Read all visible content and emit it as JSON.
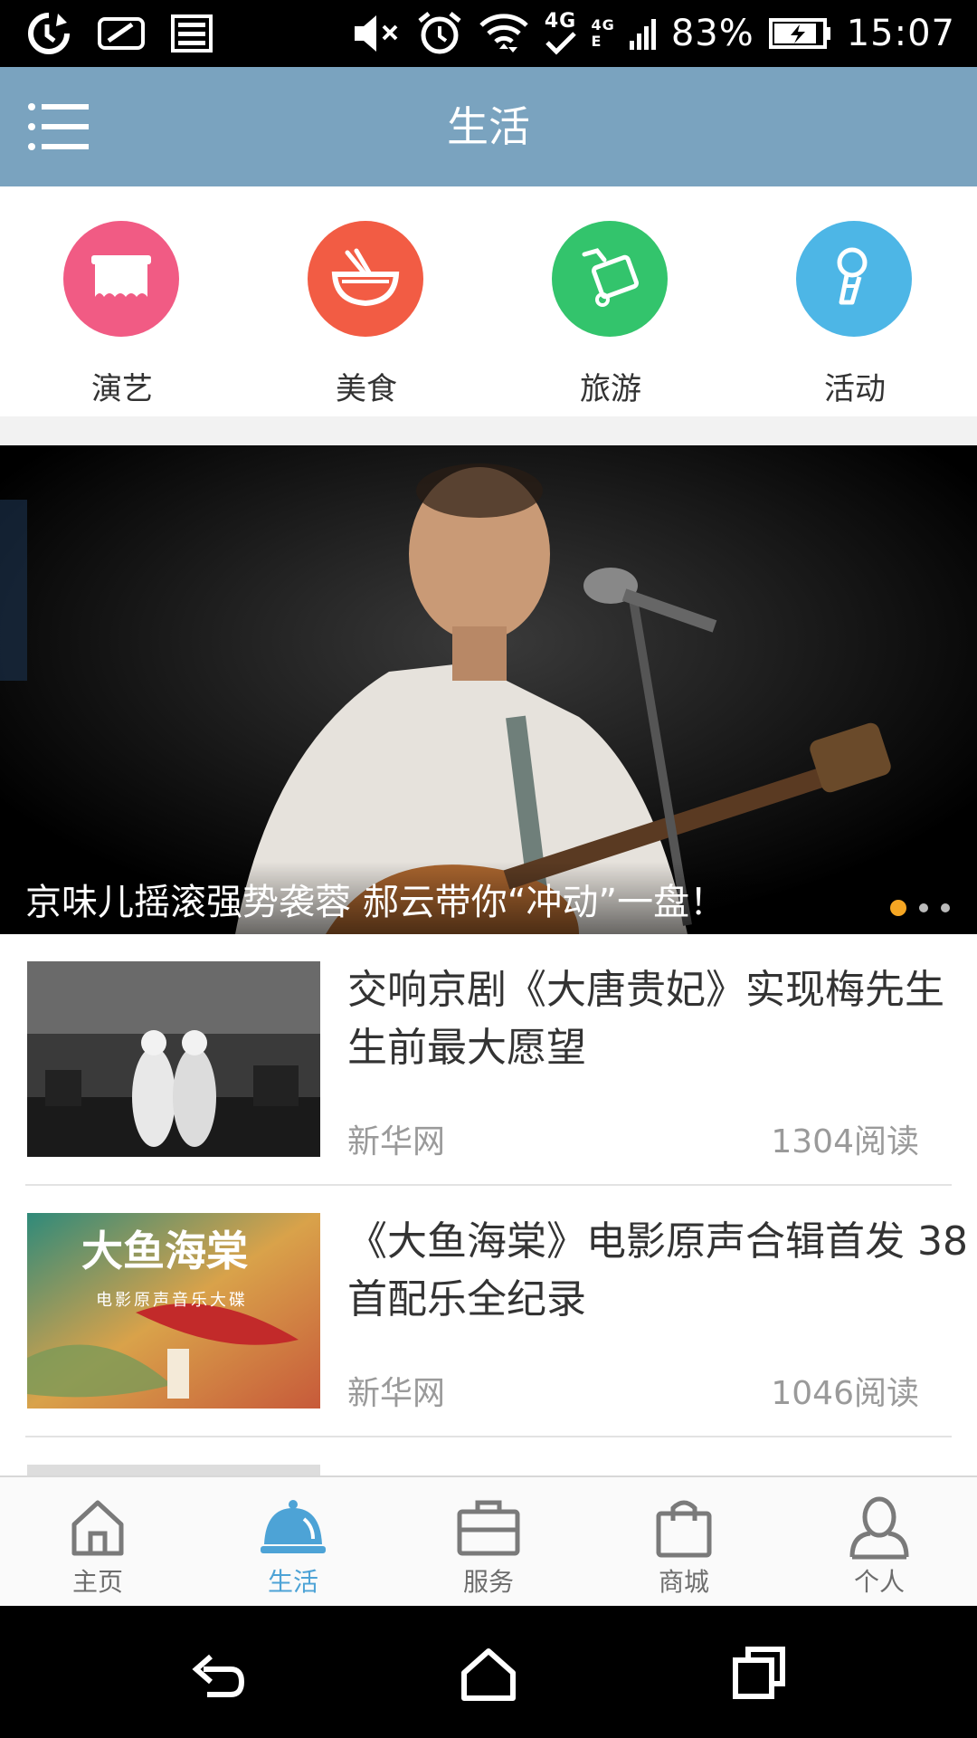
{
  "status_bar": {
    "battery": "83%",
    "time": "15:07",
    "network": "4G",
    "network_small": "4G",
    "network_e": "E"
  },
  "header": {
    "title": "生活"
  },
  "categories": [
    {
      "label": "演艺",
      "icon": "stage-icon",
      "color": "#f15b84"
    },
    {
      "label": "美食",
      "icon": "bowl-icon",
      "color": "#f25c44"
    },
    {
      "label": "旅游",
      "icon": "luggage-icon",
      "color": "#33c46c"
    },
    {
      "label": "活动",
      "icon": "microphone-icon",
      "color": "#4db6e6"
    }
  ],
  "banner": {
    "caption": "京味儿摇滚强势袭蓉 郝云带你“冲动”一盘！",
    "slide_count": 3,
    "active_slide": 1
  },
  "news": [
    {
      "title": "交响京剧《大唐贵妃》实现梅先生生前最大愿望",
      "source": "新华网",
      "reads": "1304阅读"
    },
    {
      "title": "《大鱼海棠》电影原声合辑首发 38首配乐全纪录",
      "source": "新华网",
      "reads": "1046阅读",
      "thumb_text": "大鱼海棠",
      "thumb_sub": "电影原声音乐大碟"
    }
  ],
  "tabs": [
    {
      "label": "主页",
      "icon": "home-icon",
      "active": false
    },
    {
      "label": "生活",
      "icon": "bell-icon",
      "active": true
    },
    {
      "label": "服务",
      "icon": "briefcase-icon",
      "active": false
    },
    {
      "label": "商城",
      "icon": "shopping-bag-icon",
      "active": false
    },
    {
      "label": "个人",
      "icon": "person-icon",
      "active": false
    }
  ],
  "colors": {
    "header": "#7aa3bf",
    "tab_active": "#4da3d6",
    "dot_active": "#f5a623"
  }
}
